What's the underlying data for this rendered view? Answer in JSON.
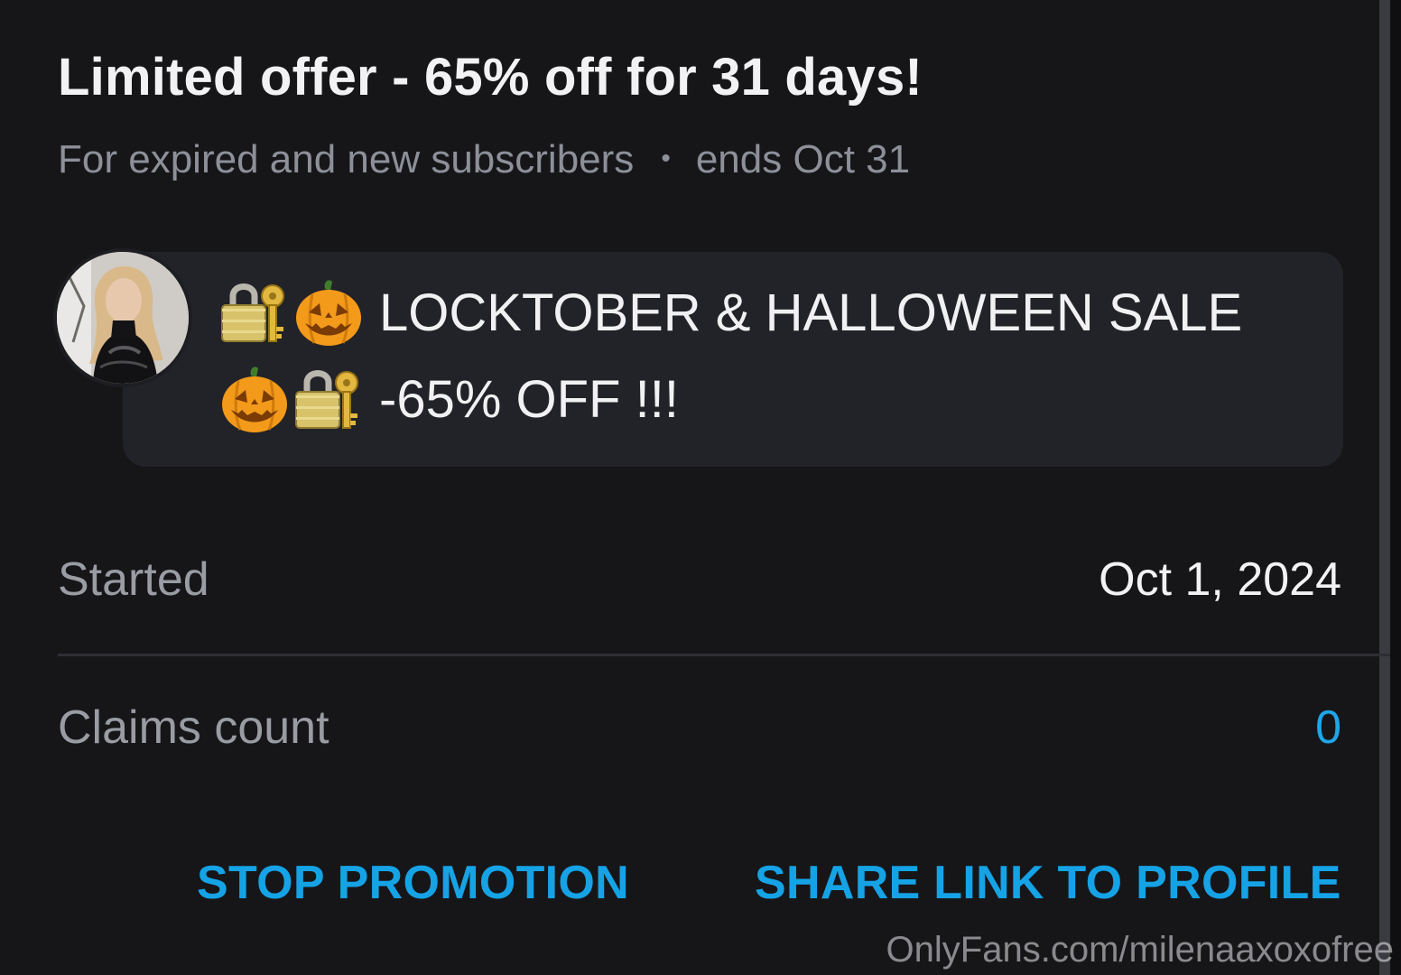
{
  "offer": {
    "title": "Limited offer - 65% off for 31 days!",
    "audience": "For expired and new subscribers",
    "separator": "•",
    "ends": "ends Oct 31"
  },
  "message": {
    "line1_text": "LOCKTOBER & HALLOWEEN SALE",
    "line2_text": "-65% OFF !!!",
    "line1_icons": [
      "lock-with-key-icon",
      "jack-o-lantern-icon"
    ],
    "line2_icons": [
      "jack-o-lantern-icon",
      "lock-with-key-icon"
    ]
  },
  "details": {
    "started_label": "Started",
    "started_value": "Oct 1, 2024",
    "claims_label": "Claims count",
    "claims_value": "0"
  },
  "actions": {
    "stop_label": "STOP PROMOTION",
    "share_label": "SHARE LINK TO PROFILE"
  },
  "watermark": "OnlyFans.com/milenaaxoxofree",
  "colors": {
    "background": "#161619",
    "bubble": "#222328",
    "accent": "#15a3e6",
    "muted_text": "#8d9099"
  }
}
